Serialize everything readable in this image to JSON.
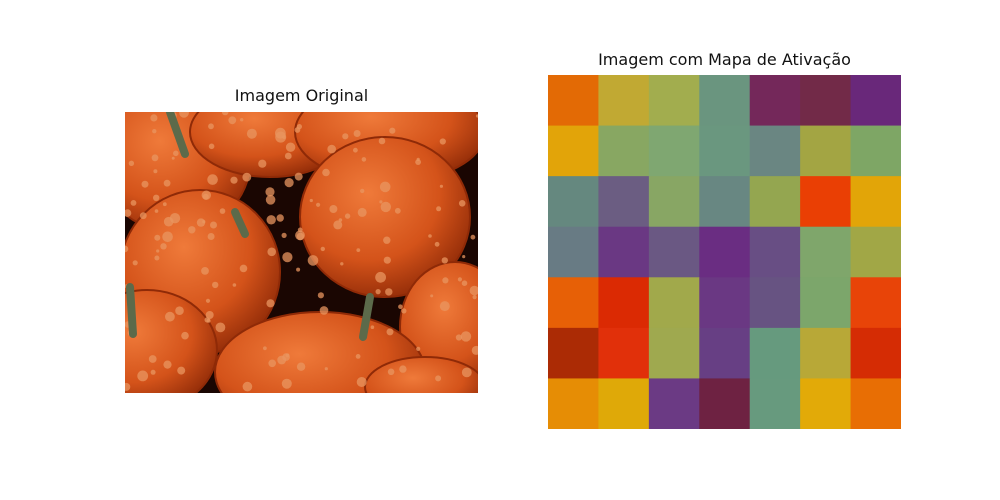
{
  "panels": {
    "left_title": "Imagem Original",
    "right_title": "Imagem com Mapa de Ativação"
  },
  "photo": {
    "subject": "close-up of warty orange pumpkins",
    "colors": {
      "shadow": "#1a0602",
      "pumpkin_dark": "#8f2a07",
      "pumpkin": "#d4531a",
      "highlight": "#ef7a3a",
      "wart": "#e89560",
      "stem": "#5c6a4a"
    }
  },
  "heatmap": {
    "rows": 7,
    "cols": 7,
    "cells": [
      [
        "#e36a05",
        "#c1a933",
        "#a2ad4e",
        "#6a957f",
        "#74285a",
        "#722a48",
        "#69287a"
      ],
      [
        "#e2a409",
        "#88a762",
        "#7fa771",
        "#6a977f",
        "#6a8682",
        "#a3a543",
        "#7ea665"
      ],
      [
        "#65887f",
        "#6b5d82",
        "#88a664",
        "#688782",
        "#94a650",
        "#ea3f04",
        "#e2a508"
      ],
      [
        "#687b84",
        "#6a3883",
        "#6a5883",
        "#6a2d82",
        "#684e84",
        "#7fa66b",
        "#a1a746"
      ],
      [
        "#e76006",
        "#db2a03",
        "#a1a94b",
        "#6a3883",
        "#675382",
        "#7ca66b",
        "#e84408"
      ],
      [
        "#ab2b05",
        "#e1300a",
        "#9fa94f",
        "#673f84",
        "#669a7e",
        "#b8a837",
        "#d52c04"
      ],
      [
        "#e68d05",
        "#dfa908",
        "#6b3a84",
        "#6e2242",
        "#679a7e",
        "#e2aa08",
        "#e86e04"
      ]
    ]
  }
}
